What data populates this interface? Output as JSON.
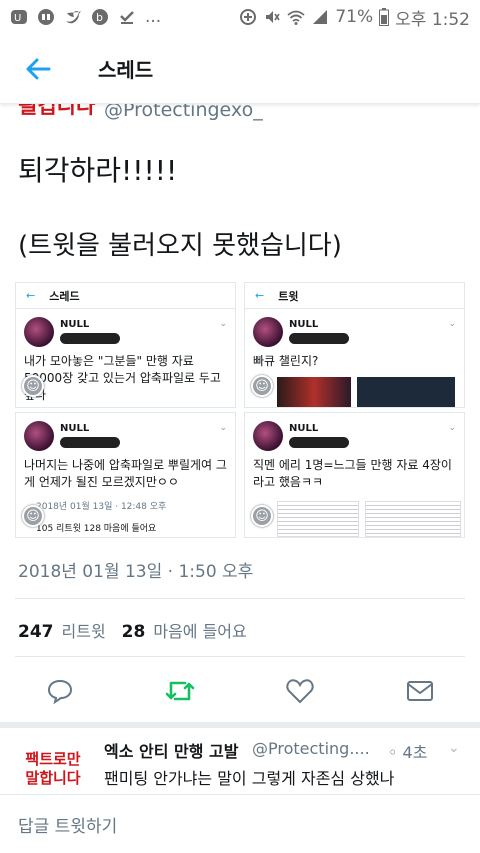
{
  "status_bar": {
    "battery": "71%",
    "time": "오후 1:52",
    "more": "..."
  },
  "header": {
    "title": "스레드"
  },
  "prev_tweet": {
    "tag": "될겁니다",
    "handle": "@Protectingexo_"
  },
  "tweet": {
    "line1": "퇴각하라!!!!!",
    "line2": "(트윗을 불러오지 못했습니다)",
    "date": "2018년 01월 13일 · 1:50 오후",
    "retweets": "247",
    "retweets_label": "리트윗",
    "likes": "28",
    "likes_label": "마음에 들어요"
  },
  "screenshots": {
    "p1": {
      "top": "스레드",
      "name": "NULL",
      "text": "내가 모아놓은 \"그분들\" 만행 자료 50000장 갖고 있는거 압축파일로 두고 싶다"
    },
    "p2": {
      "top": "트윗",
      "name": "NULL",
      "text": "빠큐 챌린지?"
    },
    "p3": {
      "name": "NULL",
      "text": "나머지는 나중에 압축파일로 뿌릴게여 그게 언제가 될진 모르겠지만ㅇㅇ",
      "date": "2018년 01월 13일 · 12:48 오후",
      "stats": "105 리트윗   128 마음에 들어요"
    },
    "p4": {
      "name": "NULL",
      "text": "직멘 에리 1명=느그들 만행 자료 4장이라고 했음ㅋㅋ"
    }
  },
  "reply": {
    "tag": "팩트로만 말합니다",
    "name": "엑소 안티 만행 고발",
    "handle": "@Protecting....",
    "time": "◦ 4초",
    "text": "팬미팅 안가냐는 말이 그렇게 자존심 상했나"
  },
  "composer": {
    "placeholder": "답글 트윗하기"
  },
  "colors": {
    "accent": "#1da1f2",
    "retweet": "#17bf63",
    "red": "#d0161b",
    "muted": "#657786"
  }
}
